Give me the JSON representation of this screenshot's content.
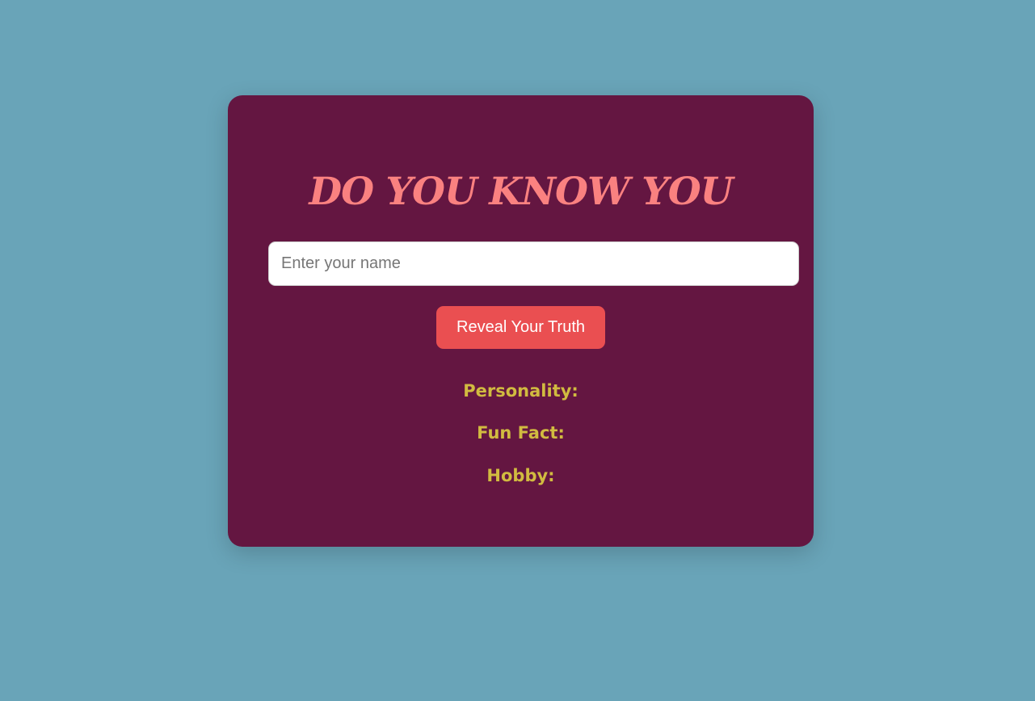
{
  "app": {
    "title": "DO YOU KNOW YOU"
  },
  "form": {
    "name_input": {
      "placeholder": "Enter your name",
      "value": ""
    },
    "submit_label": "Reveal Your Truth"
  },
  "results": {
    "personality_label": "Personality:",
    "fun_fact_label": "Fun Fact:",
    "hobby_label": "Hobby:"
  },
  "colors": {
    "page_background": "#69a4b8",
    "card_background": "#641641",
    "title": "#fa8180",
    "button": "#ea4f51",
    "result_text": "#d1bb40"
  }
}
